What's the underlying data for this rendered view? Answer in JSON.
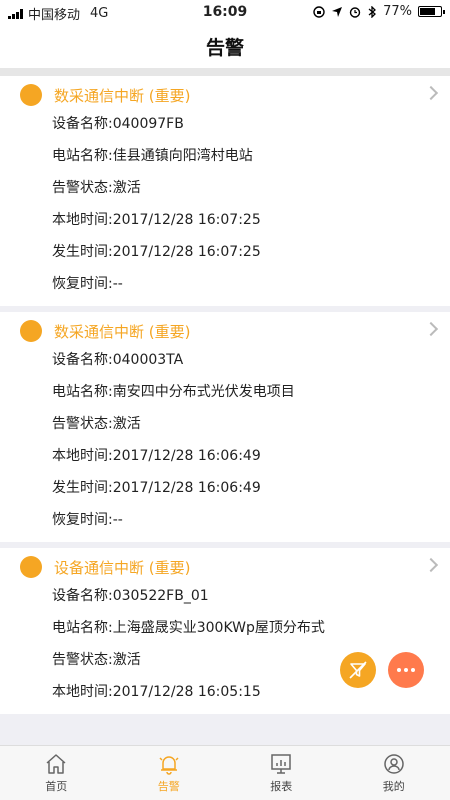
{
  "status_bar": {
    "carrier": "中国移动",
    "network": "4G",
    "time": "16:09",
    "battery": "77%",
    "battery_level": 0.77
  },
  "header": {
    "title": "告警"
  },
  "alarms": [
    {
      "title": "数采通信中断 (重要)",
      "rows": [
        {
          "label": "设备名称:",
          "value": "040097FB"
        },
        {
          "label": "电站名称:",
          "value": "佳县通镇向阳湾村电站"
        },
        {
          "label": "告警状态:",
          "value": "激活"
        },
        {
          "label": "本地时间:",
          "value": "2017/12/28 16:07:25"
        },
        {
          "label": "发生时间:",
          "value": "2017/12/28 16:07:25"
        },
        {
          "label": "恢复时间:",
          "value": "--"
        }
      ]
    },
    {
      "title": "数采通信中断 (重要)",
      "rows": [
        {
          "label": "设备名称:",
          "value": "040003TA"
        },
        {
          "label": "电站名称:",
          "value": "南安四中分布式光伏发电项目"
        },
        {
          "label": "告警状态:",
          "value": "激活"
        },
        {
          "label": "本地时间:",
          "value": "2017/12/28 16:06:49"
        },
        {
          "label": "发生时间:",
          "value": "2017/12/28 16:06:49"
        },
        {
          "label": "恢复时间:",
          "value": "--"
        }
      ]
    },
    {
      "title": "设备通信中断 (重要)",
      "rows": [
        {
          "label": "设备名称:",
          "value": "030522FB_01"
        },
        {
          "label": "电站名称:",
          "value": "上海盛晟实业300KWp屋顶分布式"
        },
        {
          "label": "告警状态:",
          "value": "激活"
        },
        {
          "label": "本地时间:",
          "value": "2017/12/28 16:05:15"
        }
      ]
    }
  ],
  "tabs": [
    {
      "label": "首页",
      "icon": "home-icon"
    },
    {
      "label": "告警",
      "icon": "bell-icon",
      "active": true
    },
    {
      "label": "报表",
      "icon": "report-icon"
    },
    {
      "label": "我的",
      "icon": "profile-icon"
    }
  ],
  "colors": {
    "accent": "#f5a623",
    "fab_more": "#ff7a4c"
  }
}
